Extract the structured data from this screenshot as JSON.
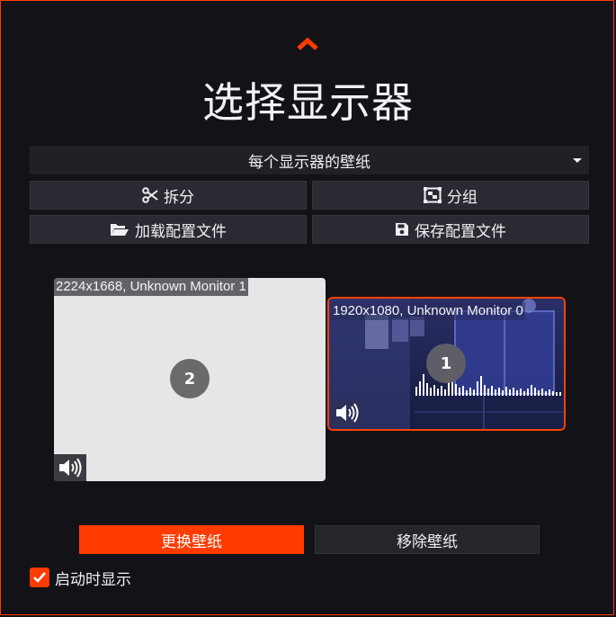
{
  "header": {
    "title": "选择显示器",
    "collapse_icon": "chevron-up-icon"
  },
  "mode_select": {
    "value": "每个显示器的壁纸"
  },
  "toolbar": {
    "split_label": "拆分",
    "split_icon": "scissors-icon",
    "group_label": "分组",
    "group_icon": "group-icon",
    "load_label": "加载配置文件",
    "load_icon": "folder-open-icon",
    "save_label": "保存配置文件",
    "save_icon": "save-icon"
  },
  "monitors": [
    {
      "label": "1920x1080, Unknown Monitor 0",
      "number": "1",
      "selected": true,
      "volume_icon": "volume-icon"
    },
    {
      "label": "2224x1668, Unknown Monitor 1",
      "number": "2",
      "selected": false,
      "volume_icon": "volume-icon"
    }
  ],
  "actions": {
    "change_label": "更换壁纸",
    "remove_label": "移除壁纸"
  },
  "startup": {
    "label": "启动时显示",
    "checked": true
  },
  "colors": {
    "accent": "#ff3b00",
    "background": "#131317",
    "button": "#2a2a32"
  }
}
